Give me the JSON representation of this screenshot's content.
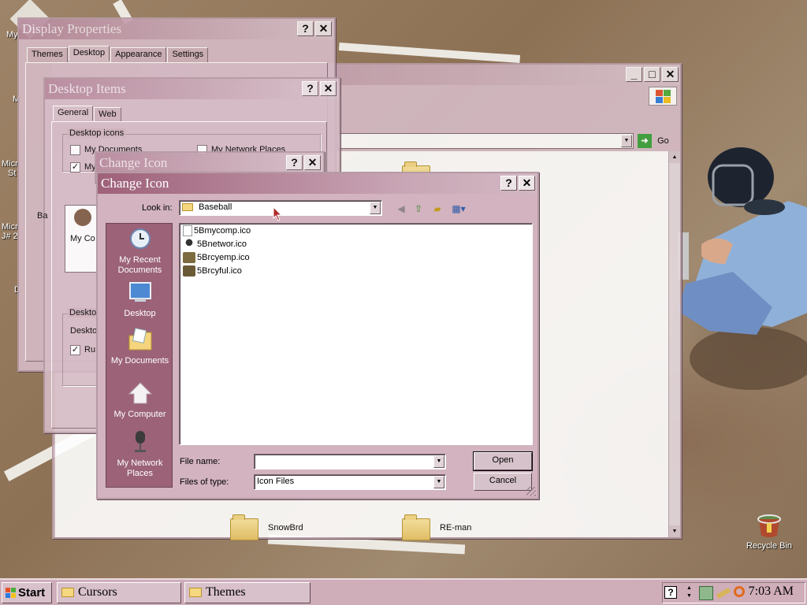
{
  "desktop": {
    "edge_labels": [
      "My",
      "M",
      "Micr",
      "St",
      "Micr",
      "J# 2",
      "D"
    ],
    "recycle_bin_label": "Recycle Bin"
  },
  "display_properties": {
    "title": "Display Properties",
    "help": "?",
    "close": "✕",
    "tabs": [
      "Themes",
      "Desktop",
      "Appearance",
      "Settings"
    ],
    "selected_tab": "Desktop"
  },
  "desktop_items": {
    "title": "Desktop Items",
    "help": "?",
    "close": "✕",
    "tabs": [
      "General",
      "Web"
    ],
    "selected_tab": "General",
    "group_label": "Desktop icons",
    "checkbox_my_documents": "My Documents",
    "checkbox_my_network_places": "My Network Places",
    "checkbox_my_computer_partial": "My",
    "icon_caption_partial": "My Co",
    "lower_group_label": "Deskto",
    "lower_text": "Deskto",
    "run_checkbox_partial": "Ru",
    "ba_partial": "Ba",
    "checks": {
      "my_documents": "",
      "my_computer": "✓",
      "run": "✓"
    }
  },
  "change_icon_back": {
    "title": "Change Icon",
    "help": "?",
    "close": "✕"
  },
  "explorer": {
    "minimize": "_",
    "maximize": "□",
    "close": "✕",
    "go_label": "Go",
    "folders": [
      {
        "name": "SnowBrd"
      },
      {
        "name": "RE-man"
      }
    ]
  },
  "change_icon_dialog": {
    "title": "Change Icon",
    "help": "?",
    "close": "✕",
    "look_in_label": "Look in:",
    "look_in_value": "Baseball",
    "places": [
      "My Recent Documents",
      "Desktop",
      "My Documents",
      "My Computer",
      "My Network Places"
    ],
    "files": [
      {
        "name": "5Bmycomp.ico",
        "icon": "document-icon"
      },
      {
        "name": "5Bnetwor.ico",
        "icon": "microphone-icon"
      },
      {
        "name": "5Brcyemp.ico",
        "icon": "baseball-icon"
      },
      {
        "name": "5Brcyful.ico",
        "icon": "baseball-icon"
      }
    ],
    "file_name_label": "File name:",
    "file_name_value": "",
    "files_of_type_label": "Files of type:",
    "files_of_type_value": "Icon Files",
    "open_button": "Open",
    "cancel_button": "Cancel"
  },
  "taskbar": {
    "start_label": "Start",
    "buttons": [
      {
        "label": "Cursors"
      },
      {
        "label": "Themes"
      }
    ],
    "clock": "7:03 AM"
  },
  "colors": {
    "window_face": "#cfadb9",
    "title_active": "#9e6179",
    "places_bar": "#9b6278"
  }
}
